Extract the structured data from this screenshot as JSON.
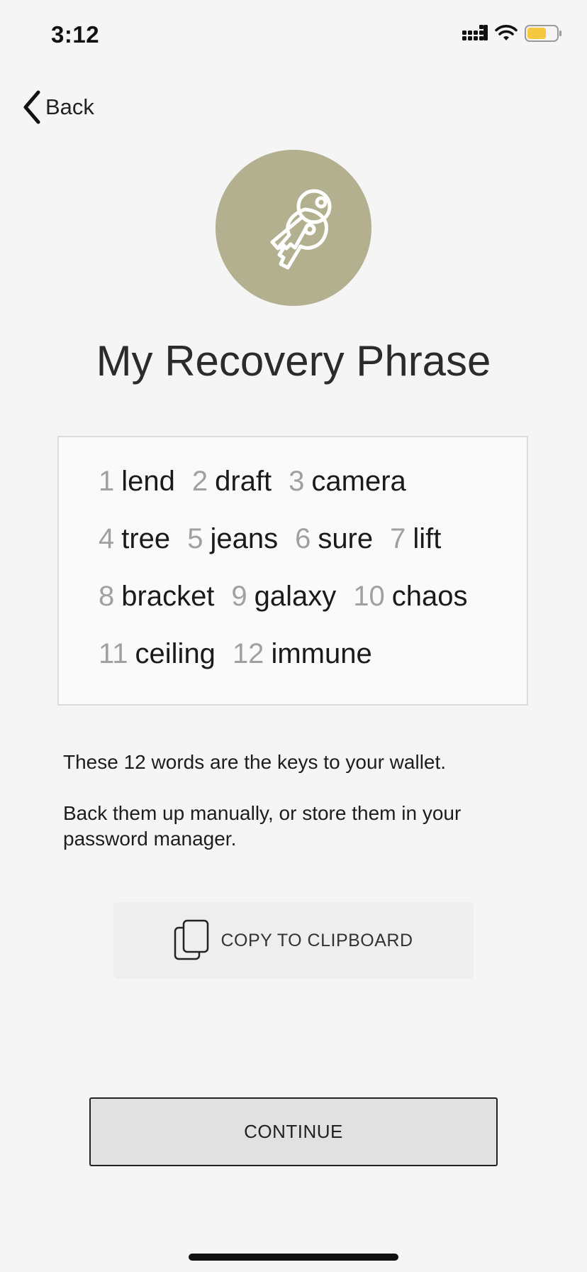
{
  "status_bar": {
    "time": "3:12",
    "battery_color": "#f5c842"
  },
  "nav": {
    "back_label": "Back"
  },
  "header": {
    "icon": "keys-icon",
    "icon_bg": "#b2b08f",
    "title": "My Recovery Phrase"
  },
  "phrase": {
    "rows": [
      [
        {
          "num": "1",
          "word": "lend"
        },
        {
          "num": "2",
          "word": "draft"
        },
        {
          "num": "3",
          "word": "camera"
        }
      ],
      [
        {
          "num": "4",
          "word": "tree"
        },
        {
          "num": "5",
          "word": "jeans"
        },
        {
          "num": "6",
          "word": "sure"
        },
        {
          "num": "7",
          "word": "lift"
        }
      ],
      [
        {
          "num": "8",
          "word": "bracket"
        },
        {
          "num": "9",
          "word": "galaxy"
        },
        {
          "num": "10",
          "word": "chaos"
        }
      ],
      [
        {
          "num": "11",
          "word": "ceiling"
        },
        {
          "num": "12",
          "word": "immune"
        }
      ]
    ]
  },
  "info": {
    "line1": "These 12 words are the keys to your wallet.",
    "line2": "Back them up manually, or store them in your password manager."
  },
  "actions": {
    "copy_label": "COPY TO CLIPBOARD",
    "copy_icon": "copy-icon",
    "continue_label": "CONTINUE"
  }
}
